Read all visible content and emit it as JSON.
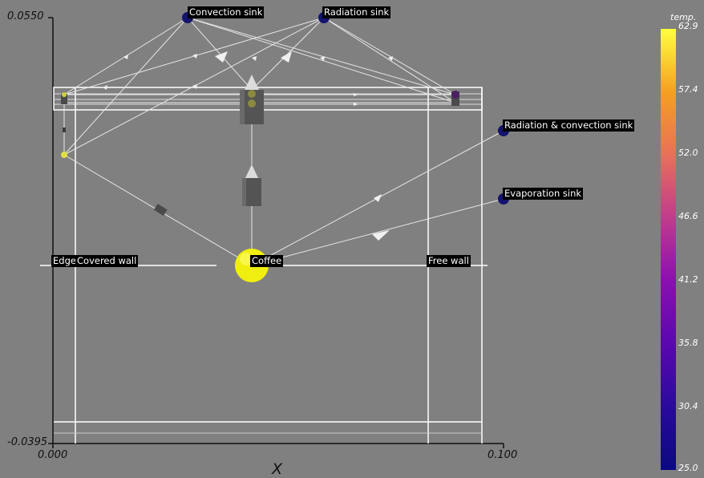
{
  "axes": {
    "y_max_label": "0.0550",
    "y_min_label": "-0.0395",
    "x_min_label": "0.000",
    "x_max_label": "0.100",
    "x_title": "X"
  },
  "nodes": {
    "convection_sink": "Convection sink",
    "radiation_sink": "Radiation sink",
    "radiation_convection_sink": "Radiation & convection sink",
    "evaporation_sink": "Evaporation sink",
    "edge": "Edge",
    "covered_wall": "Covered wall",
    "coffee": "Coffee",
    "free_wall": "Free wall"
  },
  "colorbar": {
    "title": "temp.",
    "ticks": [
      "62.9",
      "57.4",
      "52.0",
      "46.6",
      "41.2",
      "35.8",
      "30.4",
      "25.0"
    ],
    "colors": [
      "#ffff40",
      "#f5a020",
      "#e8705a",
      "#c03c8c",
      "#8a10b0",
      "#5a08b0",
      "#2a0a9c",
      "#0a0a80"
    ],
    "range": [
      25.0,
      62.9
    ]
  },
  "node_colors": {
    "sink": "#14146e",
    "coffee": "#f0ee10",
    "edge": "#e0e040"
  }
}
